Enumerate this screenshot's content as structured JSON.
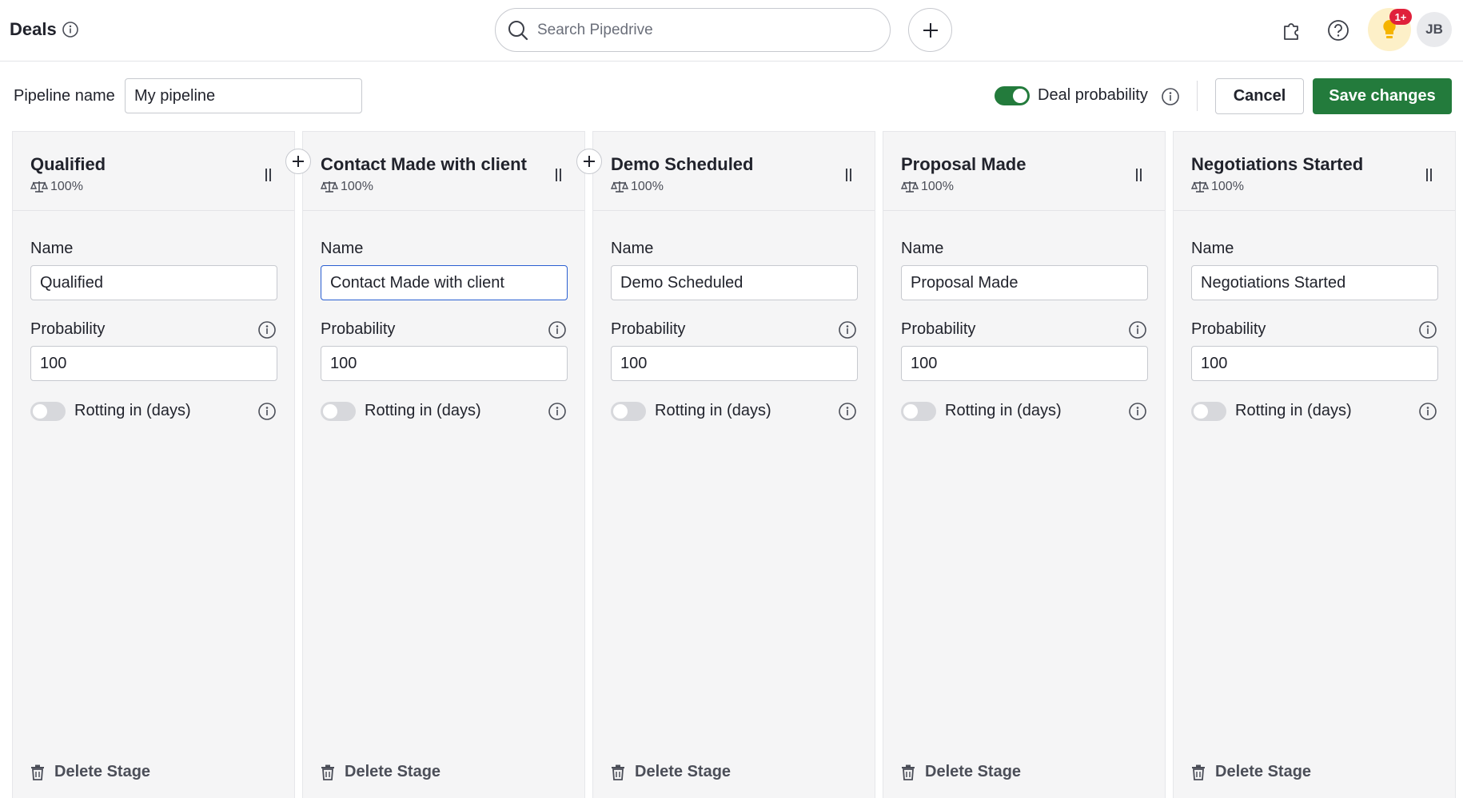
{
  "header": {
    "title": "Deals",
    "search_placeholder": "Search Pipedrive",
    "notification_badge": "1+",
    "avatar_initials": "JB"
  },
  "toolbar": {
    "pipeline_label": "Pipeline name",
    "pipeline_value": "My pipeline",
    "deal_probability_label": "Deal probability",
    "deal_probability_enabled": true,
    "cancel_label": "Cancel",
    "save_label": "Save changes"
  },
  "stage_labels": {
    "name": "Name",
    "probability": "Probability",
    "rotting": "Rotting in (days)",
    "delete": "Delete Stage"
  },
  "stages": [
    {
      "title": "Qualified",
      "prob_badge": "100%",
      "name_value": "Qualified",
      "probability_value": "100",
      "rotting_enabled": false
    },
    {
      "title": "Contact Made with client",
      "prob_badge": "100%",
      "name_value": "Contact Made with client",
      "probability_value": "100",
      "rotting_enabled": false
    },
    {
      "title": "Demo Scheduled",
      "prob_badge": "100%",
      "name_value": "Demo Scheduled",
      "probability_value": "100",
      "rotting_enabled": false
    },
    {
      "title": "Proposal Made",
      "prob_badge": "100%",
      "name_value": "Proposal Made",
      "probability_value": "100",
      "rotting_enabled": false
    },
    {
      "title": "Negotiations Started",
      "prob_badge": "100%",
      "name_value": "Negotiations Started",
      "probability_value": "100",
      "rotting_enabled": false
    }
  ],
  "colors": {
    "accent_green": "#237b3c",
    "badge_red": "#e0213b",
    "focus_blue": "#2a5fd1"
  }
}
